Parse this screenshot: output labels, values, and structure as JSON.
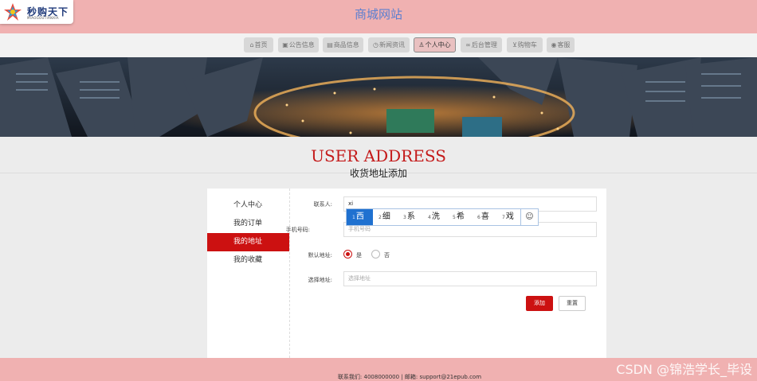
{
  "header": {
    "logo_cn": "秒购天下",
    "logo_en": "MIAOGOUTIANXIA",
    "site_title": "商城网站"
  },
  "nav": {
    "items": [
      {
        "icon": "home-icon",
        "label": "首页"
      },
      {
        "icon": "announcement-icon",
        "label": "公告信息"
      },
      {
        "icon": "product-icon",
        "label": "商品信息"
      },
      {
        "icon": "news-icon",
        "label": "新闻资讯"
      },
      {
        "icon": "user-icon",
        "label": "个人中心"
      },
      {
        "icon": "link-icon",
        "label": "后台管理"
      },
      {
        "icon": "cart-icon",
        "label": "购物车"
      },
      {
        "icon": "service-icon",
        "label": "客服"
      }
    ],
    "active_index": 4
  },
  "page": {
    "title_en": "USER ADDRESS",
    "title_cn": "收货地址添加"
  },
  "sidebar": {
    "items": [
      {
        "label": "个人中心"
      },
      {
        "label": "我的订单"
      },
      {
        "label": "我的地址"
      },
      {
        "label": "我的收藏"
      }
    ],
    "active_index": 2
  },
  "form": {
    "contact_label": "联系人:",
    "contact_value": "xi",
    "phone_label": "手机号码:",
    "phone_placeholder": "手机号码",
    "default_label": "默认地址:",
    "default_yes": "是",
    "default_no": "否",
    "default_selected": "是",
    "address_label": "选择地址:",
    "address_placeholder": "选择地址",
    "add_button": "添加",
    "reset_button": "重置"
  },
  "ime": {
    "candidates": [
      {
        "n": "1",
        "c": "西"
      },
      {
        "n": "2",
        "c": "细"
      },
      {
        "n": "3",
        "c": "系"
      },
      {
        "n": "4",
        "c": "洗"
      },
      {
        "n": "5",
        "c": "希"
      },
      {
        "n": "6",
        "c": "喜"
      },
      {
        "n": "7",
        "c": "戏"
      }
    ],
    "selected_index": 0,
    "emoji_icon": "emoji-icon"
  },
  "footer": {
    "text": "联系我们: 4008000000 | 邮箱: support@21epub.com"
  },
  "watermark": {
    "text": "CSDN @锦浩学长_毕设"
  },
  "colors": {
    "header_bg": "#f0b1b1",
    "accent_red": "#cc1111",
    "title_blue": "#5b7fd0",
    "ime_selected": "#1f71d0"
  }
}
